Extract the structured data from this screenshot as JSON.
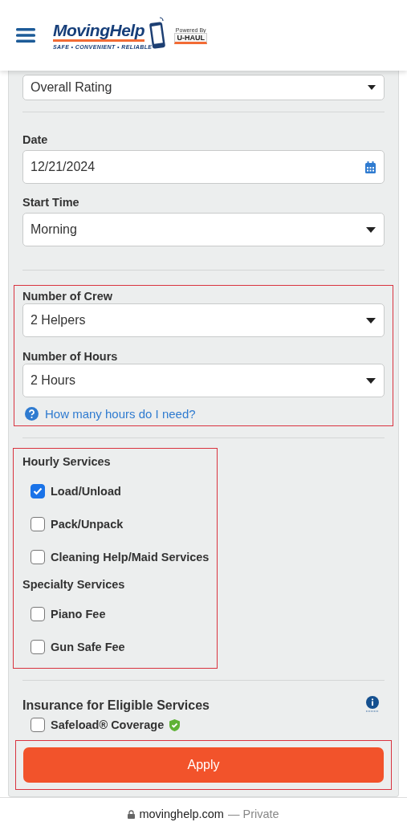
{
  "header": {
    "logo_name": "MovingHelp",
    "logo_tagline": "SAFE • CONVENIENT • RELIABLE",
    "powered_by": "Powered By",
    "partner": "U-HAUL"
  },
  "rating_select": {
    "value": "Overall Rating"
  },
  "date": {
    "label": "Date",
    "value": "12/21/2024"
  },
  "start_time": {
    "label": "Start Time",
    "value": "Morning"
  },
  "crew": {
    "label": "Number of Crew",
    "value": "2 Helpers"
  },
  "hours": {
    "label": "Number of Hours",
    "value": "2 Hours"
  },
  "help_link": "How many hours do I need?",
  "service_groups": [
    {
      "title": "Hourly Services",
      "items": [
        {
          "label": "Load/Unload",
          "checked": true
        },
        {
          "label": "Pack/Unpack",
          "checked": false
        },
        {
          "label": "Cleaning Help/Maid Services",
          "checked": false
        }
      ]
    },
    {
      "title": "Specialty Services",
      "items": [
        {
          "label": "Piano Fee",
          "checked": false
        },
        {
          "label": "Gun Safe Fee",
          "checked": false
        }
      ]
    }
  ],
  "insurance": {
    "title": "Insurance for Eligible Services",
    "option": {
      "label": "Safeload® Coverage",
      "checked": false
    }
  },
  "apply_button": "Apply",
  "browser_bar": {
    "domain": "movinghelp.com",
    "mode": "— Private"
  }
}
